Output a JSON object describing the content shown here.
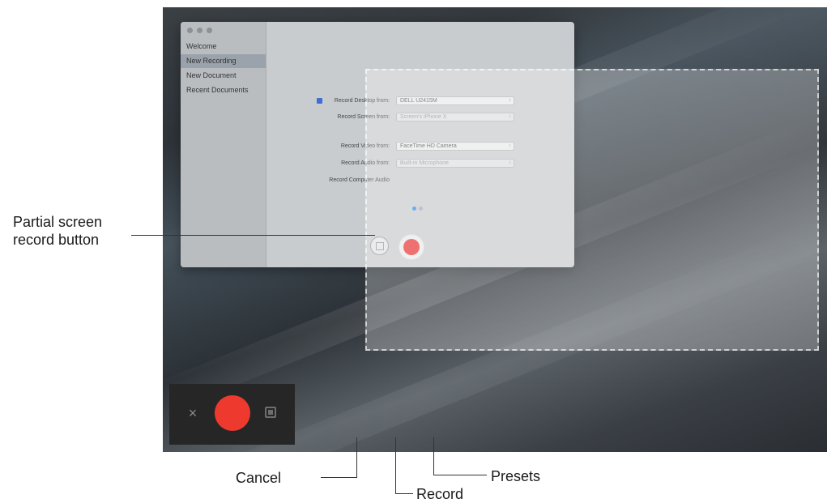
{
  "window": {
    "sidebar_items": [
      "Welcome",
      "New Recording",
      "New Document",
      "Recent Documents"
    ],
    "rows": [
      {
        "label": "Record Desktop from:",
        "value": "DELL U2415M",
        "checked": true
      },
      {
        "label": "Record Screen from:",
        "value": "Screen's iPhone X",
        "checked": false
      },
      {
        "label": "Record Video from:",
        "value": "FaceTime HD Camera",
        "checked": false
      },
      {
        "label": "Record Audio from:",
        "value": "Built-in Microphone",
        "checked": false
      },
      {
        "label": "Record Computer Audio",
        "value": "",
        "checked": false
      }
    ]
  },
  "toolbar": {
    "cancel_glyph": "×"
  },
  "callouts": {
    "partial_line1": "Partial screen",
    "partial_line2": "record button",
    "cancel": "Cancel",
    "record": "Record",
    "presets": "Presets"
  },
  "colors": {
    "record_red": "#ee3a2e",
    "toolbar_bg": "#262626",
    "checkbox_blue": "#3d6fd6"
  },
  "icons": [
    "close-icon",
    "record-icon",
    "presets-icon",
    "partial-screen-icon",
    "record-circle-icon"
  ]
}
